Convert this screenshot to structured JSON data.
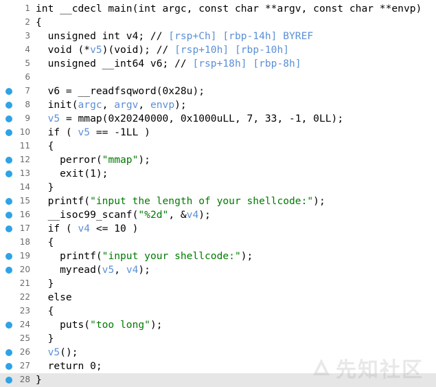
{
  "code_lines": [
    {
      "n": "1",
      "bp": false,
      "seg": [
        {
          "t": "int __cdecl main(int argc, const char **argv, const char **envp)"
        }
      ]
    },
    {
      "n": "2",
      "bp": false,
      "seg": [
        {
          "t": "{"
        }
      ]
    },
    {
      "n": "3",
      "bp": false,
      "seg": [
        {
          "t": "  unsigned int v4; // "
        },
        {
          "t": "[rsp+Ch] [rbp-14h] BYREF",
          "c": "c"
        }
      ]
    },
    {
      "n": "4",
      "bp": false,
      "seg": [
        {
          "t": "  void (*"
        },
        {
          "t": "v5",
          "c": "c"
        },
        {
          "t": ")(void); // "
        },
        {
          "t": "[rsp+10h] [rbp-10h]",
          "c": "c"
        }
      ]
    },
    {
      "n": "5",
      "bp": false,
      "seg": [
        {
          "t": "  unsigned __int64 v6; // "
        },
        {
          "t": "[rsp+18h] [rbp-8h]",
          "c": "c"
        }
      ]
    },
    {
      "n": "6",
      "bp": false,
      "seg": [
        {
          "t": ""
        }
      ]
    },
    {
      "n": "7",
      "bp": true,
      "seg": [
        {
          "t": "  v6 = __readfsqword(0x28u);"
        }
      ]
    },
    {
      "n": "8",
      "bp": true,
      "seg": [
        {
          "t": "  init("
        },
        {
          "t": "argc",
          "c": "c"
        },
        {
          "t": ", "
        },
        {
          "t": "argv",
          "c": "c"
        },
        {
          "t": ", "
        },
        {
          "t": "envp",
          "c": "c"
        },
        {
          "t": ");"
        }
      ]
    },
    {
      "n": "9",
      "bp": true,
      "seg": [
        {
          "t": "  "
        },
        {
          "t": "v5",
          "c": "c"
        },
        {
          "t": " = mmap(0x20240000, 0x1000uLL, 7, 33, -1, 0LL);"
        }
      ]
    },
    {
      "n": "10",
      "bp": true,
      "seg": [
        {
          "t": "  if ( "
        },
        {
          "t": "v5",
          "c": "c"
        },
        {
          "t": " == -1LL )"
        }
      ]
    },
    {
      "n": "11",
      "bp": false,
      "seg": [
        {
          "t": "  {"
        }
      ]
    },
    {
      "n": "12",
      "bp": true,
      "seg": [
        {
          "t": "    perror("
        },
        {
          "t": "\"mmap\"",
          "c": "s"
        },
        {
          "t": ");"
        }
      ]
    },
    {
      "n": "13",
      "bp": true,
      "seg": [
        {
          "t": "    exit(1);"
        }
      ]
    },
    {
      "n": "14",
      "bp": false,
      "seg": [
        {
          "t": "  }"
        }
      ]
    },
    {
      "n": "15",
      "bp": true,
      "seg": [
        {
          "t": "  printf("
        },
        {
          "t": "\"input the length of your shellcode:\"",
          "c": "s"
        },
        {
          "t": ");"
        }
      ]
    },
    {
      "n": "16",
      "bp": true,
      "seg": [
        {
          "t": "  __isoc99_scanf("
        },
        {
          "t": "\"%2d\"",
          "c": "s"
        },
        {
          "t": ", &"
        },
        {
          "t": "v4",
          "c": "c"
        },
        {
          "t": ");"
        }
      ]
    },
    {
      "n": "17",
      "bp": true,
      "seg": [
        {
          "t": "  if ( "
        },
        {
          "t": "v4",
          "c": "c"
        },
        {
          "t": " <= 10 )"
        }
      ]
    },
    {
      "n": "18",
      "bp": false,
      "seg": [
        {
          "t": "  {"
        }
      ]
    },
    {
      "n": "19",
      "bp": true,
      "seg": [
        {
          "t": "    printf("
        },
        {
          "t": "\"input your shellcode:\"",
          "c": "s"
        },
        {
          "t": ");"
        }
      ]
    },
    {
      "n": "20",
      "bp": true,
      "seg": [
        {
          "t": "    myread("
        },
        {
          "t": "v5",
          "c": "c"
        },
        {
          "t": ", "
        },
        {
          "t": "v4",
          "c": "c"
        },
        {
          "t": ");"
        }
      ]
    },
    {
      "n": "21",
      "bp": false,
      "seg": [
        {
          "t": "  }"
        }
      ]
    },
    {
      "n": "22",
      "bp": false,
      "seg": [
        {
          "t": "  else"
        }
      ]
    },
    {
      "n": "23",
      "bp": false,
      "seg": [
        {
          "t": "  {"
        }
      ]
    },
    {
      "n": "24",
      "bp": true,
      "seg": [
        {
          "t": "    puts("
        },
        {
          "t": "\"too long\"",
          "c": "s"
        },
        {
          "t": ");"
        }
      ]
    },
    {
      "n": "25",
      "bp": false,
      "seg": [
        {
          "t": "  }"
        }
      ]
    },
    {
      "n": "26",
      "bp": true,
      "seg": [
        {
          "t": "  "
        },
        {
          "t": "v5",
          "c": "c"
        },
        {
          "t": "();"
        }
      ]
    },
    {
      "n": "27",
      "bp": true,
      "seg": [
        {
          "t": "  return 0;"
        }
      ]
    },
    {
      "n": "28",
      "bp": true,
      "hl": true,
      "seg": [
        {
          "t": "}"
        }
      ]
    }
  ],
  "colors": {
    "breakpoint_dot": "#2ea3e6",
    "comment_variable": "#5b8fd6",
    "string": "#007a00",
    "current_line_background": "#e6e6e6"
  },
  "watermark": {
    "text": "先知社区",
    "icon": "xianzhi-logo-icon"
  }
}
